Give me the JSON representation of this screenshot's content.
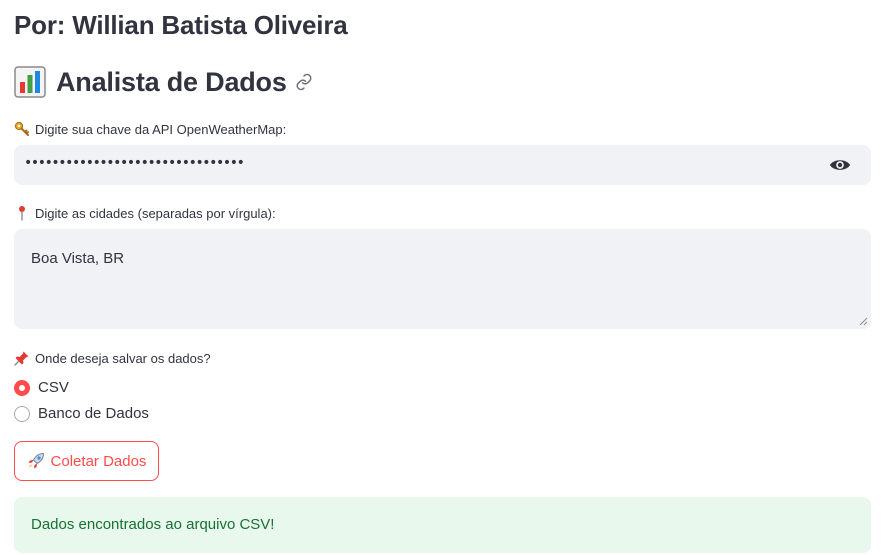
{
  "author": "Por: Willian Batista Oliveira",
  "header": {
    "title": "Analista de Dados"
  },
  "api_key": {
    "label": "Digite sua chave da API OpenWeatherMap:",
    "value": "••••••••••••••••••••••••••••••••"
  },
  "cities": {
    "label": "Digite as cidades (separadas por vírgula):",
    "value": "Boa Vista, BR"
  },
  "storage": {
    "label": "Onde deseja salvar os dados?",
    "options": [
      {
        "label": "CSV",
        "selected": true
      },
      {
        "label": "Banco de Dados",
        "selected": false
      }
    ]
  },
  "collect_button": {
    "label": "Coletar Dados"
  },
  "alert": {
    "message": "Dados encontrados ao arquivo CSV!"
  },
  "colors": {
    "accent": "#ff4b4b",
    "success_bg": "#e8f8ec",
    "success_text": "#177233",
    "input_bg": "#f0f2f6"
  }
}
